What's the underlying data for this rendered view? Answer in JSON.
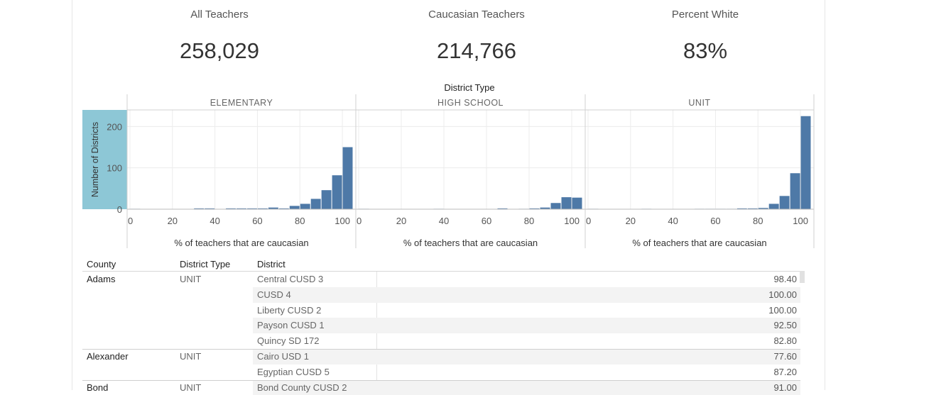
{
  "kpis": [
    {
      "label": "All Teachers",
      "value": "258,029"
    },
    {
      "label": "Caucasian Teachers",
      "value": "214,766"
    },
    {
      "label": "Percent White",
      "value": "83%"
    }
  ],
  "chart_data": {
    "type": "bar",
    "title": "District Type",
    "ylabel": "Number of Districts",
    "xlabel": "% of teachers that are caucasian",
    "xlim": [
      0,
      100
    ],
    "ylim": [
      0,
      240
    ],
    "xticks": [
      "0",
      "20",
      "40",
      "60",
      "80",
      "100"
    ],
    "yticks": [
      "0",
      "100",
      "200"
    ],
    "bin_width": 5,
    "panels": [
      {
        "name": "ELEMENTARY",
        "bins": [
          0,
          5,
          10,
          15,
          20,
          25,
          30,
          35,
          40,
          45,
          50,
          55,
          60,
          65,
          70,
          75,
          80,
          85,
          90,
          95
        ],
        "values": [
          1,
          0,
          0,
          0,
          0,
          0,
          2,
          2,
          0,
          2,
          2,
          2,
          2,
          4,
          2,
          8,
          13,
          25,
          46,
          82,
          150
        ]
      },
      {
        "name": "HIGH SCHOOL",
        "bins": [
          0,
          5,
          10,
          15,
          20,
          25,
          30,
          35,
          40,
          45,
          50,
          55,
          60,
          65,
          70,
          75,
          80,
          85,
          90,
          95
        ],
        "values": [
          1,
          0,
          0,
          0,
          0,
          0,
          0,
          1,
          0,
          0,
          0,
          0,
          0,
          2,
          0,
          1,
          2,
          4,
          15,
          29,
          28
        ]
      },
      {
        "name": "UNIT",
        "bins": [
          0,
          5,
          10,
          15,
          20,
          25,
          30,
          35,
          40,
          45,
          50,
          55,
          60,
          65,
          70,
          75,
          80,
          85,
          90,
          95
        ],
        "values": [
          1,
          0,
          0,
          0,
          0,
          1,
          0,
          0,
          0,
          0,
          1,
          1,
          1,
          1,
          2,
          2,
          3,
          13,
          32,
          87,
          225
        ]
      }
    ]
  },
  "table": {
    "headers": {
      "county": "County",
      "district_type": "District Type",
      "district": "District"
    },
    "rows": [
      {
        "county": "Adams",
        "type": "UNIT",
        "district": "Central CUSD 3",
        "value": "98.40"
      },
      {
        "county": "",
        "type": "",
        "district": "CUSD 4",
        "value": "100.00"
      },
      {
        "county": "",
        "type": "",
        "district": "Liberty CUSD 2",
        "value": "100.00"
      },
      {
        "county": "",
        "type": "",
        "district": "Payson CUSD 1",
        "value": "92.50"
      },
      {
        "county": "",
        "type": "",
        "district": "Quincy SD 172",
        "value": "82.80"
      },
      {
        "county": "Alexander",
        "type": "UNIT",
        "district": "Cairo USD 1",
        "value": "77.60"
      },
      {
        "county": "",
        "type": "",
        "district": "Egyptian CUSD 5",
        "value": "87.20"
      },
      {
        "county": "Bond",
        "type": "UNIT",
        "district": "Bond County CUSD 2",
        "value": "91.00"
      }
    ]
  },
  "colors": {
    "bar": "#4e79a7",
    "axis_highlight": "#8dc7d6",
    "grid": "#ececec",
    "row_band": "#f3f3f3"
  }
}
